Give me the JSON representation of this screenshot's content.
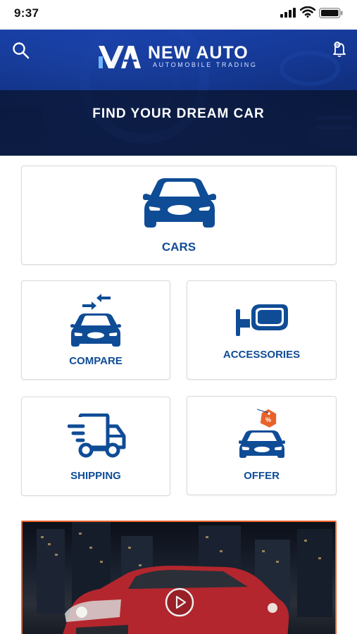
{
  "status_bar": {
    "time": "9:37",
    "icons": [
      "signal-icon",
      "wifi-icon",
      "battery-icon"
    ]
  },
  "header": {
    "brand_name": "NEW AUTO",
    "brand_tagline": "AUTOMOBILE TRADING",
    "headline": "FIND YOUR DREAM CAR",
    "left_icon": "search-icon",
    "right_icon": "bell-icon",
    "notification_count": "0"
  },
  "tiles": [
    {
      "label": "CARS",
      "icon": "car-icon"
    },
    {
      "label": "COMPARE",
      "icon": "compare-icon"
    },
    {
      "label": "ACCESSORIES",
      "icon": "side-mirror-icon"
    },
    {
      "label": "SHIPPING",
      "icon": "delivery-truck-icon"
    },
    {
      "label": "OFFER",
      "icon": "offer-tag-car-icon"
    }
  ],
  "promo": {
    "icon": "play-icon"
  },
  "colors": {
    "primary": "#0f4c96",
    "header_blue": "#1a3f9e",
    "tag_orange": "#e8632b",
    "tile_border": "#d9d9d9"
  }
}
